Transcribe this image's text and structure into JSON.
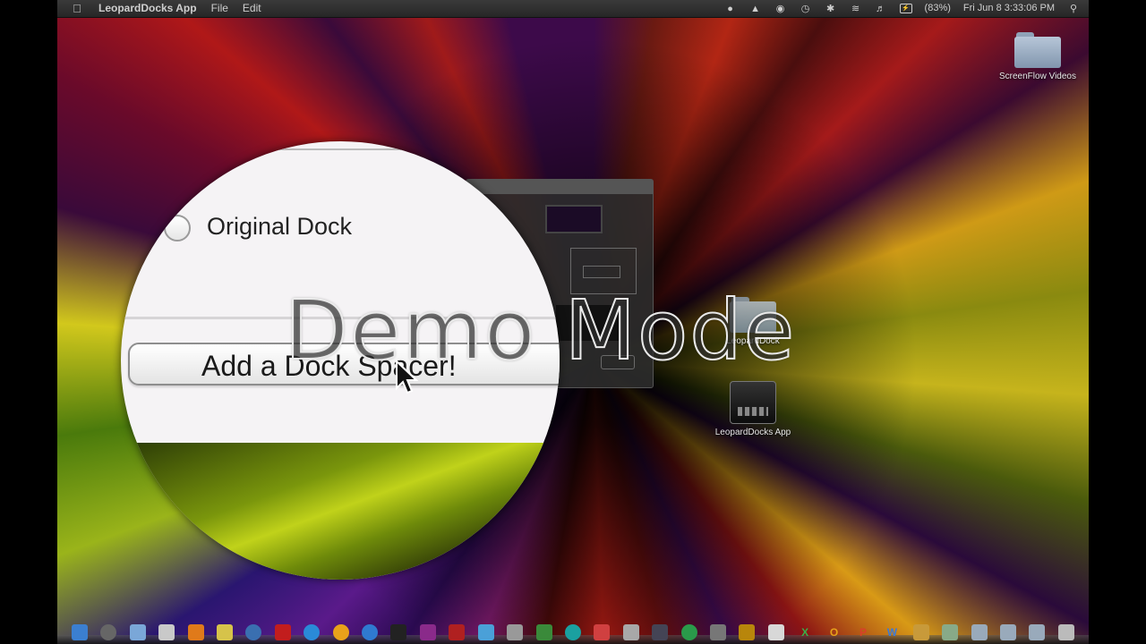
{
  "menubar": {
    "apple_icon": "apple-icon",
    "app_name": "LeopardDocks App",
    "menus": [
      "File",
      "Edit"
    ],
    "status": {
      "battery_percent": "(83%)",
      "datetime": "Fri Jun 8  3:33:06 PM"
    }
  },
  "desktop": {
    "icons": [
      {
        "label": "ScreenFlow Videos",
        "type": "folder"
      },
      {
        "label": "LeopardDock",
        "type": "folder"
      },
      {
        "label": "LeopardDocks App",
        "type": "app"
      }
    ]
  },
  "magnifier": {
    "radio_label": "Original Dock",
    "button_label": "Add a Dock Spacer!"
  },
  "overlay": {
    "text": "Demo Mode"
  },
  "dock": {
    "items": [
      "finder",
      "clock",
      "mail",
      "preview",
      "photos",
      "stickies",
      "pages",
      "safari",
      "calendar",
      "ical",
      "chrome",
      "firefox",
      "terminal",
      "photo-booth",
      "itunes",
      "textedit",
      "utilities",
      "app-store",
      "quicktime",
      "screenflow",
      "activity",
      "printer",
      "keychain",
      "grab",
      "archive",
      "spotify",
      "calculator",
      "mail-2",
      "preview-2",
      "scripts",
      "settings",
      "excel",
      "outlook",
      "powerpoint",
      "word",
      "messages",
      "help",
      "downloads",
      "applications",
      "documents",
      "trash"
    ],
    "letter_items": [
      "X",
      "O",
      "P",
      "W"
    ]
  }
}
